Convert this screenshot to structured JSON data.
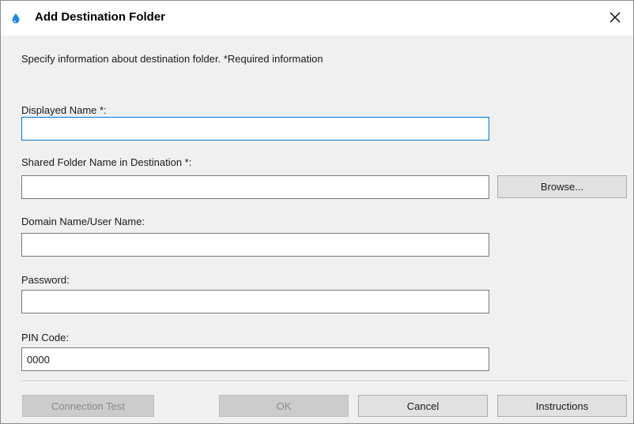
{
  "window": {
    "title": "Add Destination Folder",
    "icon": "water-drop-icon",
    "close_icon": "close-icon"
  },
  "instruction": "Specify information about destination folder. *Required information",
  "fields": {
    "displayed_name": {
      "label": "Displayed Name *:",
      "value": ""
    },
    "shared_folder": {
      "label": "Shared Folder Name in Destination *:",
      "value": ""
    },
    "domain_user": {
      "label": "Domain Name/User Name:",
      "value": ""
    },
    "password": {
      "label": "Password:",
      "value": ""
    },
    "pin_code": {
      "label": "PIN Code:",
      "value": "0000"
    }
  },
  "buttons": {
    "browse": "Browse...",
    "connection_test": "Connection Test",
    "ok": "OK",
    "cancel": "Cancel",
    "instructions": "Instructions"
  },
  "colors": {
    "focus_border": "#0078d7",
    "icon_blue": "#1e88e5"
  }
}
